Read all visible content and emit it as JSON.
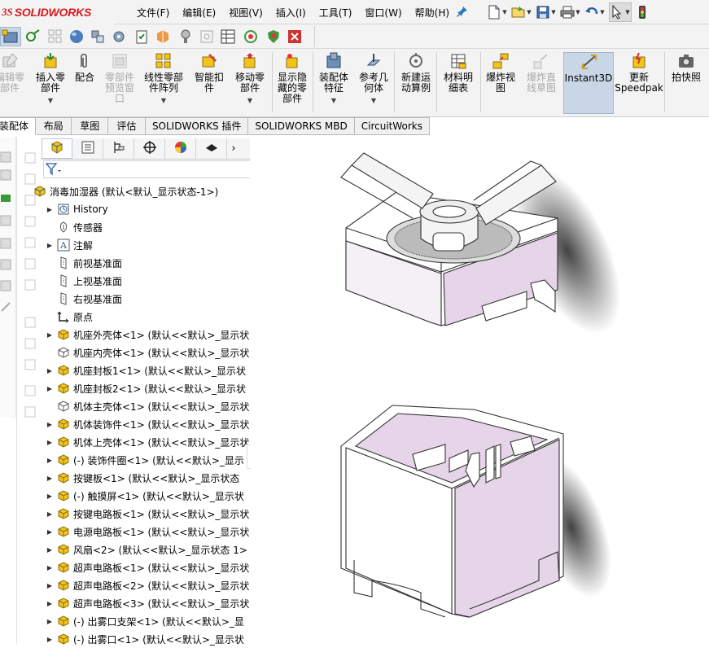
{
  "app": {
    "logo_prefix": "3S",
    "logo_text": "SOLIDWORKS"
  },
  "menu": [
    "文件(F)",
    "编辑(E)",
    "视图(V)",
    "插入(I)",
    "工具(T)",
    "窗口(W)",
    "帮助(H)"
  ],
  "ribbon": {
    "items": [
      {
        "label": "编辑零\n部件",
        "enabled": false
      },
      {
        "label": "插入零\n部件",
        "enabled": true
      },
      {
        "label": "配合",
        "enabled": true
      },
      {
        "label": "零部件\n预览窗\n口",
        "enabled": false
      },
      {
        "label": "线性零部\n件阵列",
        "enabled": true
      },
      {
        "label": "智能扣\n件",
        "enabled": true
      },
      {
        "label": "移动零\n部件",
        "enabled": true
      },
      {
        "label": "显示隐\n藏的零\n部件",
        "enabled": true
      },
      {
        "label": "装配体\n特征",
        "enabled": true
      },
      {
        "label": "参考几\n何体",
        "enabled": true
      },
      {
        "label": "新建运\n动算例",
        "enabled": true
      },
      {
        "label": "材料明\n细表",
        "enabled": true
      },
      {
        "label": "爆炸视\n图",
        "enabled": true
      },
      {
        "label": "爆炸直\n线草图",
        "enabled": false
      },
      {
        "label": "Instant3D",
        "enabled": true
      },
      {
        "label": "更新\nSpeedpak",
        "enabled": true
      },
      {
        "label": "拍快照",
        "enabled": true
      }
    ]
  },
  "tabs": [
    "装配体",
    "布局",
    "草图",
    "评估",
    "SOLIDWORKS 插件",
    "SOLIDWORKS MBD",
    "CircuitWorks"
  ],
  "tree": {
    "root": "消毒加湿器 (默认<默认_显示状态-1>)",
    "items": [
      {
        "label": "History",
        "icon": "history-icon",
        "expand": true
      },
      {
        "label": "传感器",
        "icon": "sensor-icon",
        "expand": false
      },
      {
        "label": "注解",
        "icon": "annotation-icon",
        "expand": true
      },
      {
        "label": "前视基准面",
        "icon": "plane-icon",
        "expand": false
      },
      {
        "label": "上视基准面",
        "icon": "plane-icon",
        "expand": false
      },
      {
        "label": "右视基准面",
        "icon": "plane-icon",
        "expand": false
      },
      {
        "label": "原点",
        "icon": "origin-icon",
        "expand": false
      },
      {
        "label": "机座外壳体<1> (默认<<默认>_显示状",
        "icon": "part-icon",
        "expand": true
      },
      {
        "label": "机座内壳体<1> (默认<<默认>_显示状",
        "icon": "part-outline-icon",
        "expand": false
      },
      {
        "label": "机座封板1<1> (默认<<默认>_显示状",
        "icon": "part-icon",
        "expand": true
      },
      {
        "label": "机座封板2<1> (默认<<默认>_显示状",
        "icon": "part-icon",
        "expand": true
      },
      {
        "label": "机体主壳体<1> (默认<<默认>_显示状",
        "icon": "part-outline-icon",
        "expand": false
      },
      {
        "label": "机体装饰件<1> (默认<<默认>_显示状",
        "icon": "part-icon",
        "expand": true
      },
      {
        "label": "机体上壳体<1> (默认<<默认>_显示状",
        "icon": "part-icon",
        "expand": true
      },
      {
        "label": "(-) 装饰件圈<1> (默认<<默认>_显示",
        "icon": "part-icon",
        "expand": true
      },
      {
        "label": "按键板<1> (默认<<默认>_显示状态",
        "icon": "part-icon",
        "expand": true
      },
      {
        "label": "(-) 触摸屏<1> (默认<<默认>_显示状",
        "icon": "part-icon",
        "expand": true
      },
      {
        "label": "按键电路板<1> (默认<<默认>_显示状",
        "icon": "part-icon",
        "expand": true
      },
      {
        "label": "电源电路板<1> (默认<<默认>_显示状",
        "icon": "part-icon",
        "expand": true
      },
      {
        "label": "风扇<2> (默认<<默认>_显示状态 1>",
        "icon": "part-icon",
        "expand": true
      },
      {
        "label": "超声电路板<1> (默认<<默认>_显示状",
        "icon": "part-icon",
        "expand": true
      },
      {
        "label": "超声电路板<2> (默认<<默认>_显示状",
        "icon": "part-icon",
        "expand": true
      },
      {
        "label": "超声电路板<3> (默认<<默认>_显示状",
        "icon": "part-icon",
        "expand": true
      },
      {
        "label": "(-) 出雾口支架<1> (默认<<默认>_显",
        "icon": "part-icon",
        "expand": true
      },
      {
        "label": "(-) 出雾口<1> (默认<<默认>_显示状",
        "icon": "part-icon",
        "expand": true
      }
    ]
  },
  "colors": {
    "accent": "#d7191f",
    "part_yellow": "#f2c318",
    "part_pink": "#e6d4e8",
    "active_tab": "#c8d6e6"
  }
}
